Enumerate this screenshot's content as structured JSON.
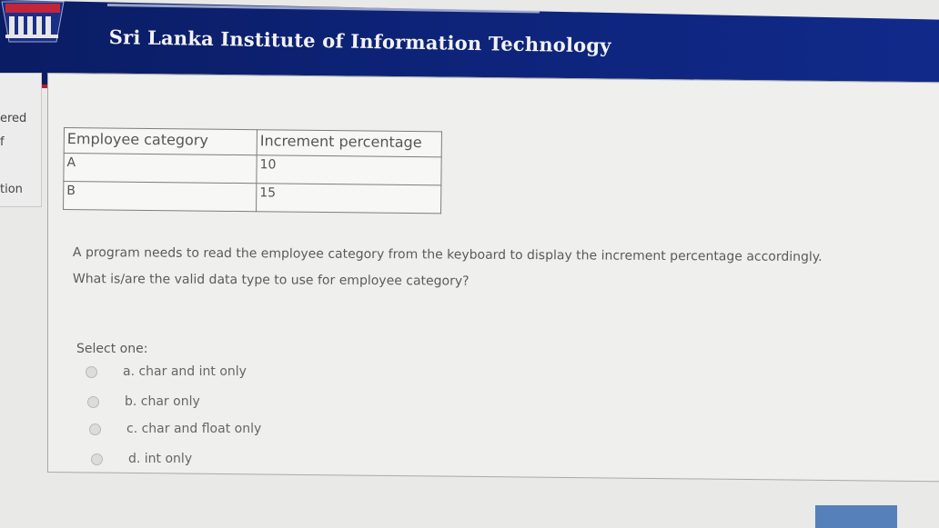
{
  "header": {
    "institute_name": "Sri Lanka Institute of Information Technology"
  },
  "side_nav": {
    "items": [
      "ered",
      "f",
      "tion"
    ]
  },
  "table": {
    "headers": [
      "Employee category",
      "Increment percentage"
    ],
    "rows": [
      [
        "A",
        "10"
      ],
      [
        "B",
        "15"
      ]
    ]
  },
  "question": {
    "line1": "A program needs to read the employee category from the keyboard to display the increment percentage accordingly.",
    "line2": "What is/are the valid data type to use for employee category?"
  },
  "answer": {
    "prompt": "Select one:",
    "options": [
      {
        "label": "a. char and int only"
      },
      {
        "label": "b. char only"
      },
      {
        "label": "c. char and float only"
      },
      {
        "label": "d. int only"
      }
    ]
  },
  "colors": {
    "header_bg": "#0d2378",
    "header_stripe": "#b0202a",
    "page_bg": "#e9e9e7"
  }
}
